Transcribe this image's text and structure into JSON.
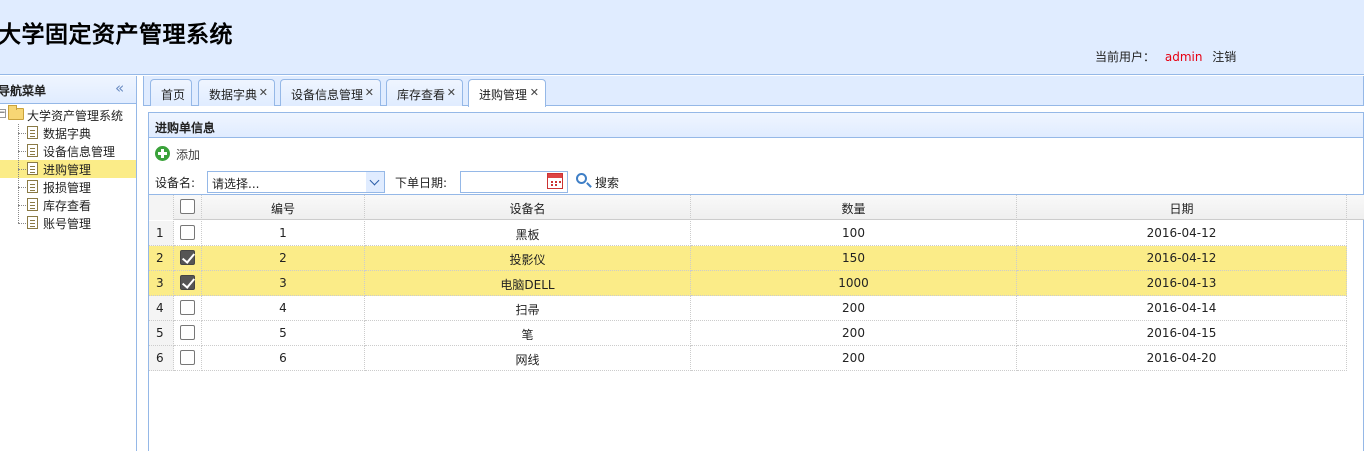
{
  "header": {
    "title": "大学固定资产管理系统",
    "current_user_label": "当前用户：",
    "user_name": "admin",
    "logout": "注销"
  },
  "sidebar": {
    "title": "导航菜单",
    "root": "大学资产管理系统",
    "items": [
      {
        "label": "数据字典"
      },
      {
        "label": "设备信息管理"
      },
      {
        "label": "进购管理"
      },
      {
        "label": "报损管理"
      },
      {
        "label": "库存查看"
      },
      {
        "label": "账号管理"
      }
    ],
    "selected": "进购管理"
  },
  "tabs": [
    {
      "label": "首页",
      "closable": false
    },
    {
      "label": "数据字典",
      "closable": true
    },
    {
      "label": "设备信息管理",
      "closable": true
    },
    {
      "label": "库存查看",
      "closable": true
    },
    {
      "label": "进购管理",
      "closable": true,
      "active": true
    }
  ],
  "panel": {
    "title": "进购单信息"
  },
  "toolbar": {
    "add_label": "添加",
    "device_label": "设备名:",
    "device_placeholder": "请选择...",
    "date_label": "下单日期:",
    "date_value": "",
    "search_label": "搜索"
  },
  "grid": {
    "columns": [
      "编号",
      "设备名",
      "数量",
      "日期"
    ],
    "rows": [
      {
        "rn": "1",
        "checked": false,
        "id": "1",
        "name": "黑板",
        "qty": "100",
        "date": "2016-04-12"
      },
      {
        "rn": "2",
        "checked": true,
        "id": "2",
        "name": "投影仪",
        "qty": "150",
        "date": "2016-04-12"
      },
      {
        "rn": "3",
        "checked": true,
        "id": "3",
        "name": "电脑DELL",
        "qty": "1000",
        "date": "2016-04-13"
      },
      {
        "rn": "4",
        "checked": false,
        "id": "4",
        "name": "扫帚",
        "qty": "200",
        "date": "2016-04-14"
      },
      {
        "rn": "5",
        "checked": false,
        "id": "5",
        "name": "笔",
        "qty": "200",
        "date": "2016-04-15"
      },
      {
        "rn": "6",
        "checked": false,
        "id": "6",
        "name": "网线",
        "qty": "200",
        "date": "2016-04-20"
      }
    ]
  },
  "colors": {
    "header_bg": "#e0ecff",
    "border": "#95b8e7",
    "selected_row": "#fbec88",
    "user_name": "#e60012"
  }
}
